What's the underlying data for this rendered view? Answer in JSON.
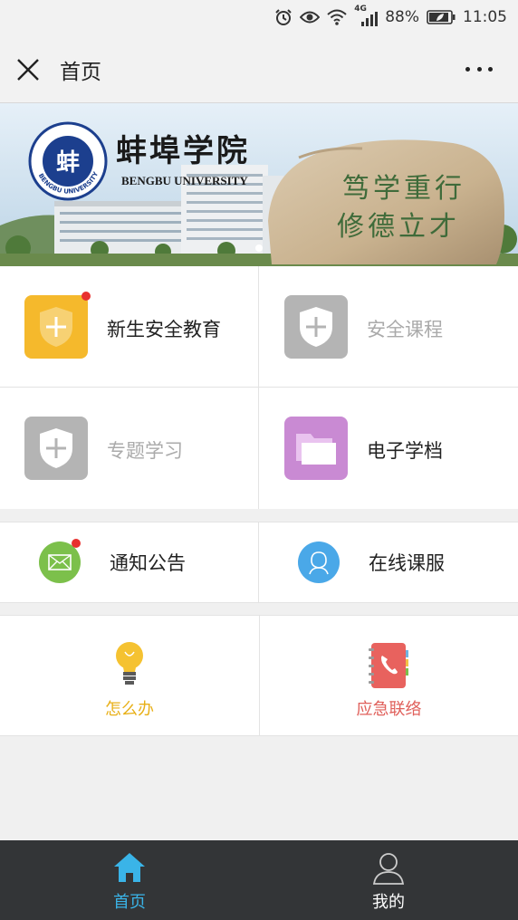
{
  "status_bar": {
    "signal_label": "4G",
    "battery_percent": "88%",
    "time": "11:05"
  },
  "header": {
    "title": "首页"
  },
  "banner": {
    "school_name_cn": "蚌埠学院",
    "school_name_en": "BENGBU UNIVERSITY",
    "seal_text": "BENGBU UNIVERSITY",
    "motto_line1": "笃学重行",
    "motto_line2": "修德立才"
  },
  "main_grid": [
    {
      "label": "新生安全教育",
      "icon": "shield-plus-icon",
      "color": "#f5b92c",
      "badge": true,
      "enabled": true
    },
    {
      "label": "安全课程",
      "icon": "shield-plus-icon",
      "color": "#b4b4b4",
      "badge": false,
      "enabled": false
    },
    {
      "label": "专题学习",
      "icon": "shield-plus-icon",
      "color": "#b4b4b4",
      "badge": false,
      "enabled": false
    },
    {
      "label": "电子学档",
      "icon": "folder-icon",
      "color": "#c98ad3",
      "badge": false,
      "enabled": true
    }
  ],
  "secondary_row": [
    {
      "label": "通知公告",
      "icon": "envelope-icon",
      "color": "#7cc04b",
      "badge": true
    },
    {
      "label": "在线课服",
      "icon": "person-icon",
      "color": "#4aa8e8",
      "badge": false
    }
  ],
  "tertiary_row": [
    {
      "label": "怎么办",
      "icon": "lightbulb-icon",
      "color": "#f0b020"
    },
    {
      "label": "应急联络",
      "icon": "phone-book-icon",
      "color": "#e8625e"
    }
  ],
  "tab_bar": {
    "tabs": [
      {
        "label": "首页",
        "icon": "home-icon",
        "active": true
      },
      {
        "label": "我的",
        "icon": "user-icon",
        "active": false
      }
    ],
    "active_color": "#3ab4e8",
    "inactive_color": "#ffffff"
  }
}
